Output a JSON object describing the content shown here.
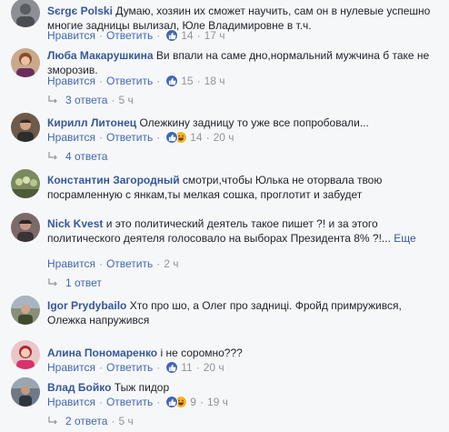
{
  "actions": {
    "like": "Нравится",
    "reply": "Ответить",
    "sep": "·"
  },
  "comments": [
    {
      "author": "Sєrgє Polski",
      "text": "Думаю, хозяин их сможет научить, сам он в нулевые успешно многие задницы вылизал, Юле Владимировне в т.ч.",
      "reactions": "14",
      "time": "17 ч"
    },
    {
      "author": "Люба Макарушкина",
      "text": "Ви впали на саме дно,нормальний мужчина б таке не зморозив.",
      "reactions": "15",
      "time": "18 ч",
      "replies": "3 ответа",
      "replies_time": "5 ч"
    },
    {
      "author": "Кирилл Литонец",
      "text": "Олежкину задницу то уже все попробовали...",
      "reactions": "14",
      "time": "20 ч",
      "replies": "4 ответа"
    },
    {
      "author": "Константин Загородный",
      "text": "смотри,чтобы Юлька не оторвала твою посрамленную с янкам,ты мелкая сошка, проглотит и забудет"
    },
    {
      "author": "Nick Kvest",
      "text": "и это политический деятель такое пишет ?! и за этого политического деятеля голосовало на выборах Президента 8% ?!...",
      "more": "Еще",
      "time": "2 ч",
      "replies": "1 ответ"
    },
    {
      "author": "Igor Prydybailo",
      "text": "Хто про шо, а Олег про задниці. Фройд примружився, Олежка напружився"
    },
    {
      "author": "Алина Пономаренко",
      "text": "і не соромно???",
      "reactions": "11",
      "time": "20 ч"
    },
    {
      "author": "Влад Бойко",
      "text": "Тыж пидор",
      "reactions": "9",
      "time": "19 ч",
      "replies": "2 ответа",
      "replies_time": "5 ч"
    }
  ]
}
